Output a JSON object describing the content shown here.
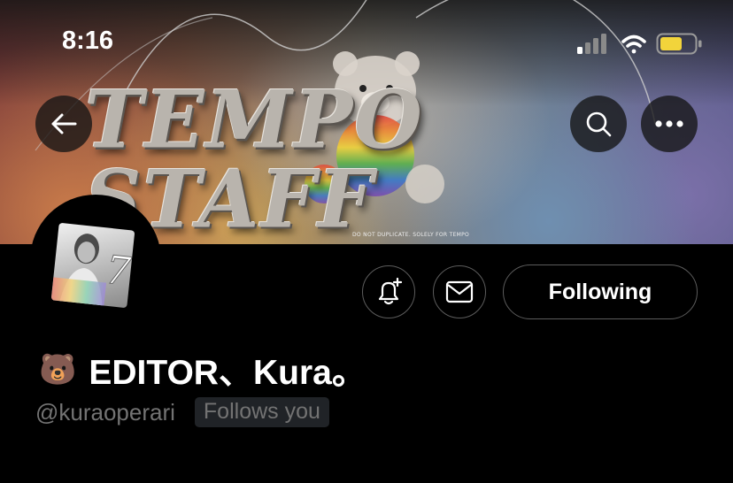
{
  "status_bar": {
    "time": "8:16"
  },
  "banner": {
    "text": "TEMPO STAFF",
    "notice": "DO NOT DUPLICATE. SOLELY FOR TEMPO"
  },
  "profile": {
    "display_name_emoji": "🐻",
    "display_name": "EDITOR、Kura。",
    "handle": "@kuraoperari",
    "follows_you": "Follows you"
  },
  "actions": {
    "following_label": "Following"
  },
  "icons": {
    "back": "arrow-left-icon",
    "search": "search-icon",
    "more": "more-horizontal-icon",
    "notify": "bell-plus-icon",
    "message": "envelope-icon",
    "signal": "cellular-signal-icon",
    "wifi": "wifi-icon",
    "battery": "battery-icon"
  },
  "colors": {
    "battery_fill": "#f2d43b",
    "secondary_text": "#737373",
    "border": "#5c5c5c"
  }
}
